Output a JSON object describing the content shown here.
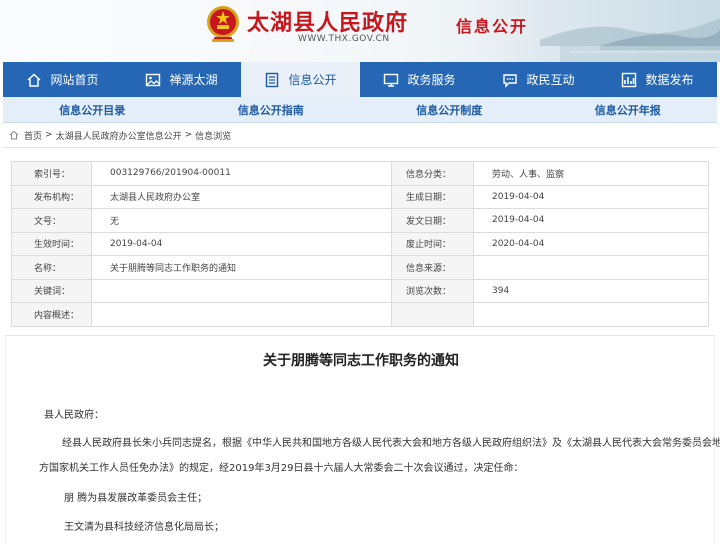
{
  "header": {
    "site_title": "太湖县人民政府",
    "site_url": "WWW.THX.GOV.CN",
    "site_subtitle": "信息公开"
  },
  "nav": [
    {
      "label": "网站首页",
      "icon": "home-icon"
    },
    {
      "label": "禅源太湖",
      "icon": "picture-icon"
    },
    {
      "label": "信息公开",
      "icon": "document-list-icon",
      "active": true
    },
    {
      "label": "政务服务",
      "icon": "monitor-icon"
    },
    {
      "label": "政民互动",
      "icon": "chat-bubble-icon"
    },
    {
      "label": "数据发布",
      "icon": "chart-icon"
    }
  ],
  "subnav": [
    "信息公开目录",
    "信息公开指南",
    "信息公开制度",
    "信息公开年报"
  ],
  "breadcrumb": {
    "home": "首页",
    "sep": ">",
    "level1": "太湖县人民政府办公室信息公开",
    "level2": "信息浏览"
  },
  "info": {
    "index_no_label": "索引号：",
    "index_no": "003129766/201904-00011",
    "category_label": "信息分类：",
    "category": "劳动、人事、监察",
    "publisher_label": "发布机构：",
    "publisher": "太湖县人民政府办公室",
    "created_label": "生成日期：",
    "created": "2019-04-04",
    "doc_no_label": "文号：",
    "doc_no": "无",
    "issued_label": "发文日期：",
    "issued": "2019-04-04",
    "effective_label": "生效时间：",
    "effective": "2019-04-04",
    "expire_label": "废止时间：",
    "expire": "2020-04-04",
    "name_label": "名称：",
    "name": "关于朋腾等同志工作职务的通知",
    "source_label": "信息来源：",
    "source": "",
    "keywords_label": "关键词：",
    "keywords": "",
    "views_label": "浏览次数：",
    "views": "394",
    "summary_label": "内容概述：",
    "summary": ""
  },
  "article": {
    "title": "关于朋腾等同志工作职务的通知",
    "salutation": "县人民政府：",
    "para1_line1": "经县人民政府县长朱小兵同志提名，根据《中华人民共和国地方各级人民代表大会和地方各级人民政府组织法》及《太湖县人民代表大会常务委员会地",
    "para1_line2": "方国家机关工作人员任免办法》的规定，经2019年3月29日县十六届人大常委会二十次会议通过，决定任命：",
    "item1": "朋  腾为县发展改革委员会主任；",
    "item2": "王文清为县科技经济信息化局局长；"
  },
  "colors": {
    "brand_red": "#c8161d",
    "nav_blue": "#2567b5",
    "subnav_bg": "#e3eef8"
  }
}
